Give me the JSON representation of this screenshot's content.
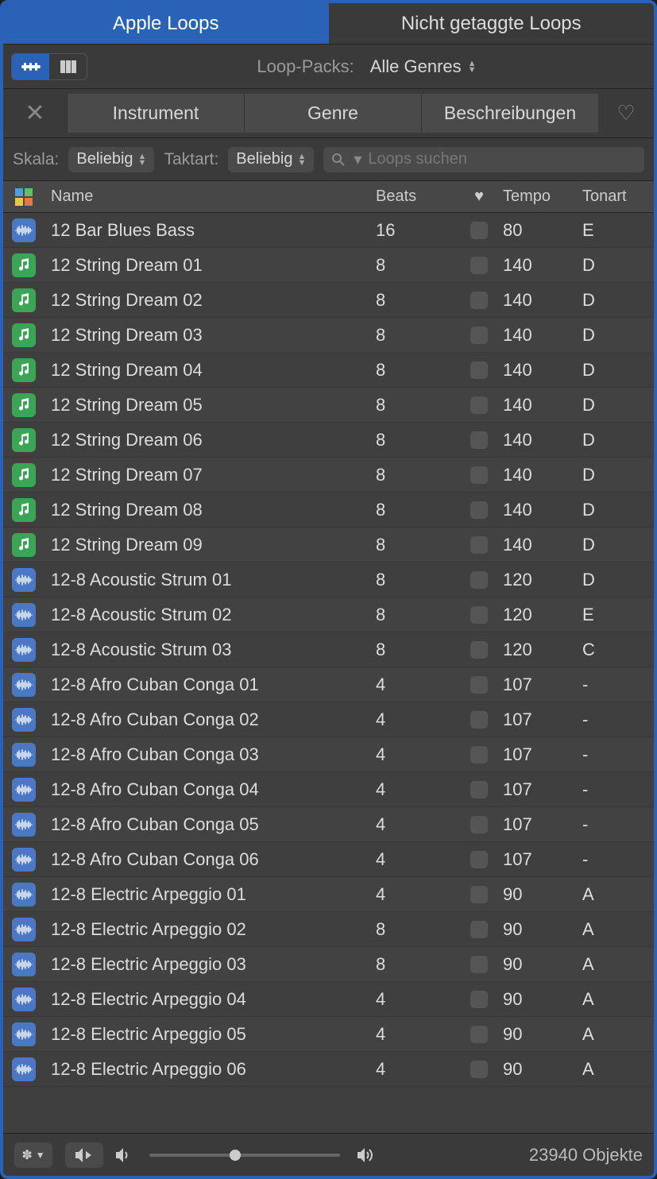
{
  "tabs": {
    "apple": "Apple Loops",
    "untagged": "Nicht getaggte Loops"
  },
  "packs": {
    "label": "Loop-Packs:",
    "value": "Alle Genres"
  },
  "categories": {
    "instrument": "Instrument",
    "genre": "Genre",
    "descriptions": "Beschreibungen"
  },
  "filters": {
    "scale_label": "Skala:",
    "scale_value": "Beliebig",
    "time_label": "Taktart:",
    "time_value": "Beliebig",
    "search_placeholder": "Loops suchen"
  },
  "columns": {
    "name": "Name",
    "beats": "Beats",
    "tempo": "Tempo",
    "key": "Tonart"
  },
  "footer": {
    "count": "23940 Objekte",
    "volume": 0.45
  },
  "loops": [
    {
      "type": "audio",
      "name": "12 Bar Blues Bass",
      "beats": "16",
      "tempo": "80",
      "key": "E"
    },
    {
      "type": "midi",
      "name": "12 String Dream 01",
      "beats": "8",
      "tempo": "140",
      "key": "D"
    },
    {
      "type": "midi",
      "name": "12 String Dream 02",
      "beats": "8",
      "tempo": "140",
      "key": "D"
    },
    {
      "type": "midi",
      "name": "12 String Dream 03",
      "beats": "8",
      "tempo": "140",
      "key": "D"
    },
    {
      "type": "midi",
      "name": "12 String Dream 04",
      "beats": "8",
      "tempo": "140",
      "key": "D"
    },
    {
      "type": "midi",
      "name": "12 String Dream 05",
      "beats": "8",
      "tempo": "140",
      "key": "D"
    },
    {
      "type": "midi",
      "name": "12 String Dream 06",
      "beats": "8",
      "tempo": "140",
      "key": "D"
    },
    {
      "type": "midi",
      "name": "12 String Dream 07",
      "beats": "8",
      "tempo": "140",
      "key": "D"
    },
    {
      "type": "midi",
      "name": "12 String Dream 08",
      "beats": "8",
      "tempo": "140",
      "key": "D"
    },
    {
      "type": "midi",
      "name": "12 String Dream 09",
      "beats": "8",
      "tempo": "140",
      "key": "D"
    },
    {
      "type": "audio",
      "name": "12-8 Acoustic Strum 01",
      "beats": "8",
      "tempo": "120",
      "key": "D"
    },
    {
      "type": "audio",
      "name": "12-8 Acoustic Strum 02",
      "beats": "8",
      "tempo": "120",
      "key": "E"
    },
    {
      "type": "audio",
      "name": "12-8 Acoustic Strum 03",
      "beats": "8",
      "tempo": "120",
      "key": "C"
    },
    {
      "type": "audio",
      "name": "12-8 Afro Cuban Conga 01",
      "beats": "4",
      "tempo": "107",
      "key": "-"
    },
    {
      "type": "audio",
      "name": "12-8 Afro Cuban Conga 02",
      "beats": "4",
      "tempo": "107",
      "key": "-"
    },
    {
      "type": "audio",
      "name": "12-8 Afro Cuban Conga 03",
      "beats": "4",
      "tempo": "107",
      "key": "-"
    },
    {
      "type": "audio",
      "name": "12-8 Afro Cuban Conga 04",
      "beats": "4",
      "tempo": "107",
      "key": "-"
    },
    {
      "type": "audio",
      "name": "12-8 Afro Cuban Conga 05",
      "beats": "4",
      "tempo": "107",
      "key": "-"
    },
    {
      "type": "audio",
      "name": "12-8 Afro Cuban Conga 06",
      "beats": "4",
      "tempo": "107",
      "key": "-"
    },
    {
      "type": "audio",
      "name": "12-8 Electric Arpeggio 01",
      "beats": "4",
      "tempo": "90",
      "key": "A"
    },
    {
      "type": "audio",
      "name": "12-8 Electric Arpeggio 02",
      "beats": "8",
      "tempo": "90",
      "key": "A"
    },
    {
      "type": "audio",
      "name": "12-8 Electric Arpeggio 03",
      "beats": "8",
      "tempo": "90",
      "key": "A"
    },
    {
      "type": "audio",
      "name": "12-8 Electric Arpeggio 04",
      "beats": "4",
      "tempo": "90",
      "key": "A"
    },
    {
      "type": "audio",
      "name": "12-8 Electric Arpeggio 05",
      "beats": "4",
      "tempo": "90",
      "key": "A"
    },
    {
      "type": "audio",
      "name": "12-8 Electric Arpeggio 06",
      "beats": "4",
      "tempo": "90",
      "key": "A"
    }
  ]
}
